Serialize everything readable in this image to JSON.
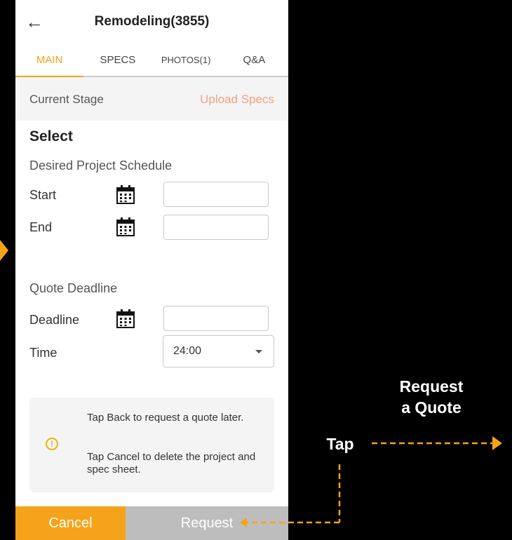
{
  "header": {
    "back_icon": "arrow-left-icon",
    "title": "Remodeling(3855)"
  },
  "tabs": [
    {
      "label": "MAIN",
      "active": true
    },
    {
      "label": "SPECS",
      "active": false
    },
    {
      "label": "PHOTOS(1)",
      "active": false
    },
    {
      "label": "Q&A",
      "active": false
    }
  ],
  "stage": {
    "label": "Current Stage",
    "upload_link": "Upload Specs"
  },
  "form": {
    "section_title": "Select",
    "schedule": {
      "heading": "Desired Project Schedule",
      "start_label": "Start",
      "start_value": "",
      "end_label": "End",
      "end_value": ""
    },
    "quote": {
      "heading": "Quote Deadline",
      "deadline_label": "Deadline",
      "deadline_value": "",
      "time_label": "Time",
      "time_value": "24:00"
    }
  },
  "info": {
    "icon": "alert-circle-icon",
    "line1": "Tap Back to request a quote later.",
    "line2": "Tap Cancel to delete the project and spec sheet."
  },
  "footer": {
    "cancel_label": "Cancel",
    "request_label": "Request"
  },
  "annotation": {
    "tap_label": "Tap",
    "request_line1": "Request",
    "request_line2": "a Quote"
  },
  "colors": {
    "accent": "#f5a31a",
    "upload_link": "#f3a07f",
    "disabled_button": "#bdbdbd",
    "info_icon": "#e7b400"
  }
}
